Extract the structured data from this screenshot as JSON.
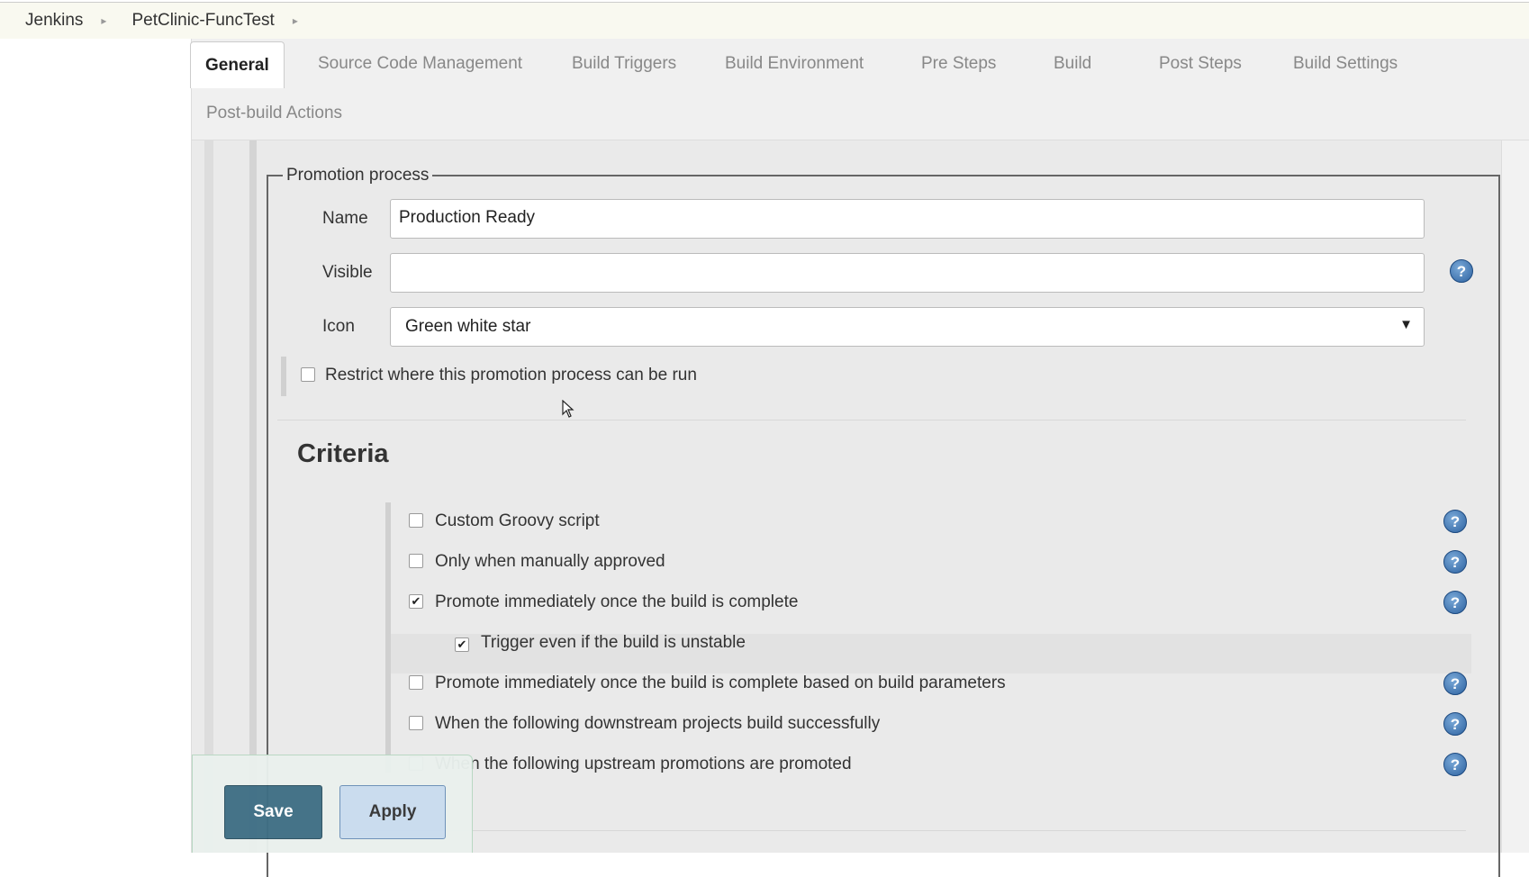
{
  "breadcrumb": {
    "items": [
      "Jenkins",
      "PetClinic-FuncTest"
    ]
  },
  "tabs": {
    "active": "General",
    "items": [
      "Source Code Management",
      "Build Triggers",
      "Build Environment",
      "Pre Steps",
      "Build",
      "Post Steps",
      "Build Settings",
      "Post-build Actions"
    ]
  },
  "promotion": {
    "legend": "Promotion process",
    "name_label": "Name",
    "name_value": "Production Ready",
    "visible_label": "Visible",
    "visible_value": "",
    "icon_label": "Icon",
    "icon_value": "Green white star",
    "restrict_label": "Restrict where this promotion process can be run",
    "restrict_checked": false
  },
  "criteria": {
    "title": "Criteria",
    "items": [
      {
        "label": "Custom Groovy script",
        "checked": false
      },
      {
        "label": "Only when manually approved",
        "checked": false
      },
      {
        "label": "Promote immediately once the build is complete",
        "checked": true
      },
      {
        "label": "Trigger even if the build is unstable",
        "checked": true
      },
      {
        "label": "Promote immediately once the build is complete based on build parameters",
        "checked": false
      },
      {
        "label": "When the following downstream projects build successfully",
        "checked": false
      },
      {
        "label": "When the following upstream promotions are promoted",
        "checked": false
      }
    ]
  },
  "buttons": {
    "save": "Save",
    "apply": "Apply"
  },
  "icons": {
    "help": "?",
    "check": "✔",
    "dropdown": "▼",
    "crumb_sep": "▸"
  },
  "colors": {
    "save_bg": "#3f6f85",
    "apply_bg": "#c9dcef",
    "help_blue": "#2d62a0"
  }
}
